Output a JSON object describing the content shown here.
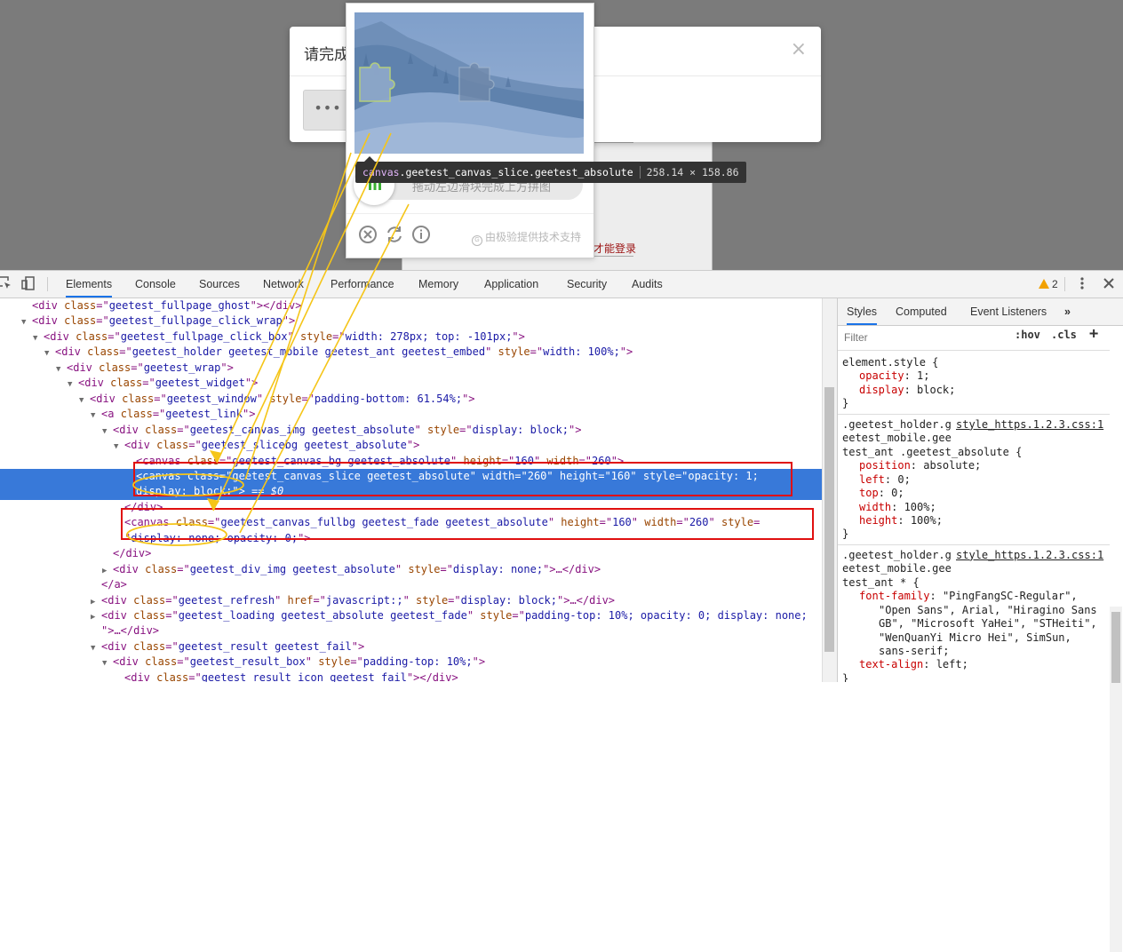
{
  "page": {
    "modal_title": "请完成",
    "modal_close": "×",
    "modal_button": "•••",
    "login_hint": "才能登录"
  },
  "geetest": {
    "slider_hint": "拖动左边滑块完成上方拼图",
    "brand_text": "由极验提供技术支持",
    "brand_mark": "G"
  },
  "tooltip": {
    "tag": "canvas",
    "classes": ".geetest_canvas_slice.geetest_absolute",
    "size": "258.14 × 158.86"
  },
  "devtools": {
    "tabs": [
      "Elements",
      "Console",
      "Sources",
      "Network",
      "Performance",
      "Memory",
      "Application",
      "Security",
      "Audits"
    ],
    "active_tab": "Elements",
    "warnings": "2"
  },
  "dom_lines": [
    {
      "indent": 2,
      "tri": "",
      "parts": [
        [
          "tg",
          "<div "
        ],
        [
          "an",
          "class"
        ],
        [
          "tg",
          "=\""
        ],
        [
          "av",
          "geetest_fullpage_ghost"
        ],
        [
          "tg",
          "\"></div>"
        ]
      ]
    },
    {
      "indent": 2,
      "tri": "▼",
      "parts": [
        [
          "tg",
          "<div "
        ],
        [
          "an",
          "class"
        ],
        [
          "tg",
          "=\""
        ],
        [
          "av",
          "geetest_fullpage_click_wrap"
        ],
        [
          "tg",
          "\">"
        ]
      ]
    },
    {
      "indent": 3,
      "tri": "▼",
      "parts": [
        [
          "tg",
          "<div "
        ],
        [
          "an",
          "class"
        ],
        [
          "tg",
          "=\""
        ],
        [
          "av",
          "geetest_fullpage_click_box"
        ],
        [
          "tg",
          "\" "
        ],
        [
          "an",
          "style"
        ],
        [
          "tg",
          "=\""
        ],
        [
          "av",
          "width: 278px; top: -101px;"
        ],
        [
          "tg",
          "\">"
        ]
      ]
    },
    {
      "indent": 4,
      "tri": "▼",
      "parts": [
        [
          "tg",
          "<div "
        ],
        [
          "an",
          "class"
        ],
        [
          "tg",
          "=\""
        ],
        [
          "av",
          "geetest_holder geetest_mobile geetest_ant geetest_embed"
        ],
        [
          "tg",
          "\" "
        ],
        [
          "an",
          "style"
        ],
        [
          "tg",
          "=\""
        ],
        [
          "av",
          "width: 100%;"
        ],
        [
          "tg",
          "\">"
        ]
      ]
    },
    {
      "indent": 5,
      "tri": "▼",
      "parts": [
        [
          "tg",
          "<div "
        ],
        [
          "an",
          "class"
        ],
        [
          "tg",
          "=\""
        ],
        [
          "av",
          "geetest_wrap"
        ],
        [
          "tg",
          "\">"
        ]
      ]
    },
    {
      "indent": 6,
      "tri": "▼",
      "parts": [
        [
          "tg",
          "<div "
        ],
        [
          "an",
          "class"
        ],
        [
          "tg",
          "=\""
        ],
        [
          "av",
          "geetest_widget"
        ],
        [
          "tg",
          "\">"
        ]
      ]
    },
    {
      "indent": 7,
      "tri": "▼",
      "parts": [
        [
          "tg",
          "<div "
        ],
        [
          "an",
          "class"
        ],
        [
          "tg",
          "=\""
        ],
        [
          "av",
          "geetest_window"
        ],
        [
          "tg",
          "\" "
        ],
        [
          "an",
          "style"
        ],
        [
          "tg",
          "=\""
        ],
        [
          "av",
          "padding-bottom: 61.54%;"
        ],
        [
          "tg",
          "\">"
        ]
      ]
    },
    {
      "indent": 8,
      "tri": "▼",
      "parts": [
        [
          "tg",
          "<a "
        ],
        [
          "an",
          "class"
        ],
        [
          "tg",
          "=\""
        ],
        [
          "av",
          "geetest_link"
        ],
        [
          "tg",
          "\">"
        ]
      ]
    },
    {
      "indent": 9,
      "tri": "▼",
      "parts": [
        [
          "tg",
          "<div "
        ],
        [
          "an",
          "class"
        ],
        [
          "tg",
          "=\""
        ],
        [
          "av",
          "geetest_canvas_img geetest_absolute"
        ],
        [
          "tg",
          "\" "
        ],
        [
          "an",
          "style"
        ],
        [
          "tg",
          "=\""
        ],
        [
          "av",
          "display: block;"
        ],
        [
          "tg",
          "\">"
        ]
      ]
    },
    {
      "indent": 10,
      "tri": "▼",
      "parts": [
        [
          "tg",
          "<div "
        ],
        [
          "an",
          "class"
        ],
        [
          "tg",
          "=\""
        ],
        [
          "av",
          "geetest_slicebg geetest_absolute"
        ],
        [
          "tg",
          "\">"
        ]
      ]
    },
    {
      "indent": 11,
      "tri": "",
      "parts": [
        [
          "tg",
          "<canvas "
        ],
        [
          "an",
          "class"
        ],
        [
          "tg",
          "=\""
        ],
        [
          "av",
          "geetest_canvas_bg geetest_absolute"
        ],
        [
          "tg",
          "\" "
        ],
        [
          "an",
          "height"
        ],
        [
          "tg",
          "=\""
        ],
        [
          "av",
          "160"
        ],
        [
          "tg",
          "\" "
        ],
        [
          "an",
          "width"
        ],
        [
          "tg",
          "=\""
        ],
        [
          "av",
          "260"
        ],
        [
          "tg",
          "\">"
        ]
      ]
    },
    {
      "indent": 11,
      "tri": "",
      "selected": true,
      "parts": [
        [
          "tg",
          "<canvas "
        ],
        [
          "an",
          "class"
        ],
        [
          "tg",
          "=\""
        ],
        [
          "av",
          "geetest_canvas_slice geetest_absolute"
        ],
        [
          "tg",
          "\" "
        ],
        [
          "an",
          "width"
        ],
        [
          "tg",
          "=\""
        ],
        [
          "av",
          "260"
        ],
        [
          "tg",
          "\" "
        ],
        [
          "an",
          "height"
        ],
        [
          "tg",
          "=\""
        ],
        [
          "av",
          "160"
        ],
        [
          "tg",
          "\" "
        ],
        [
          "an",
          "style"
        ],
        [
          "tg",
          "=\""
        ],
        [
          "av",
          "opacity: 1;"
        ]
      ]
    },
    {
      "indent": 11,
      "tri": "",
      "selected": true,
      "parts": [
        [
          "av",
          "display: block;"
        ],
        [
          "tg",
          "\">"
        ],
        [
          "dim",
          " == $0"
        ]
      ]
    },
    {
      "indent": 10,
      "tri": "",
      "parts": [
        [
          "tg",
          "</div>"
        ]
      ]
    },
    {
      "indent": 10,
      "tri": "",
      "parts": [
        [
          "tg",
          "<canvas "
        ],
        [
          "an",
          "class"
        ],
        [
          "tg",
          "=\""
        ],
        [
          "av",
          "geetest_canvas_fullbg geetest_fade geetest_absolute"
        ],
        [
          "tg",
          "\" "
        ],
        [
          "an",
          "height"
        ],
        [
          "tg",
          "=\""
        ],
        [
          "av",
          "160"
        ],
        [
          "tg",
          "\" "
        ],
        [
          "an",
          "width"
        ],
        [
          "tg",
          "=\""
        ],
        [
          "av",
          "260"
        ],
        [
          "tg",
          "\" "
        ],
        [
          "an",
          "style"
        ],
        [
          "tg",
          "="
        ]
      ]
    },
    {
      "indent": 10,
      "tri": "",
      "parts": [
        [
          "tg",
          "\""
        ],
        [
          "av",
          "display: none; opacity: 0;"
        ],
        [
          "tg",
          "\">"
        ]
      ]
    },
    {
      "indent": 9,
      "tri": "",
      "parts": [
        [
          "tg",
          "</div>"
        ]
      ]
    },
    {
      "indent": 9,
      "tri": "▶",
      "parts": [
        [
          "tg",
          "<div "
        ],
        [
          "an",
          "class"
        ],
        [
          "tg",
          "=\""
        ],
        [
          "av",
          "geetest_div_img geetest_absolute"
        ],
        [
          "tg",
          "\" "
        ],
        [
          "an",
          "style"
        ],
        [
          "tg",
          "=\""
        ],
        [
          "av",
          "display: none;"
        ],
        [
          "tg",
          "\">…</div>"
        ]
      ]
    },
    {
      "indent": 8,
      "tri": "",
      "parts": [
        [
          "tg",
          "</a>"
        ]
      ]
    },
    {
      "indent": 8,
      "tri": "▶",
      "parts": [
        [
          "tg",
          "<div "
        ],
        [
          "an",
          "class"
        ],
        [
          "tg",
          "=\""
        ],
        [
          "av",
          "geetest_refresh"
        ],
        [
          "tg",
          "\" "
        ],
        [
          "an",
          "href"
        ],
        [
          "tg",
          "=\""
        ],
        [
          "av",
          "javascript:;"
        ],
        [
          "tg",
          "\" "
        ],
        [
          "an",
          "style"
        ],
        [
          "tg",
          "=\""
        ],
        [
          "av",
          "display: block;"
        ],
        [
          "tg",
          "\">…</div>"
        ]
      ]
    },
    {
      "indent": 8,
      "tri": "▶",
      "parts": [
        [
          "tg",
          "<div "
        ],
        [
          "an",
          "class"
        ],
        [
          "tg",
          "=\""
        ],
        [
          "av",
          "geetest_loading geetest_absolute geetest_fade"
        ],
        [
          "tg",
          "\" "
        ],
        [
          "an",
          "style"
        ],
        [
          "tg",
          "=\""
        ],
        [
          "av",
          "padding-top: 10%; opacity: 0; display: none;"
        ]
      ]
    },
    {
      "indent": 8,
      "tri": "",
      "parts": [
        [
          "tg",
          "\">…</div>"
        ]
      ]
    },
    {
      "indent": 8,
      "tri": "▼",
      "parts": [
        [
          "tg",
          "<div "
        ],
        [
          "an",
          "class"
        ],
        [
          "tg",
          "=\""
        ],
        [
          "av",
          "geetest_result geetest_fail"
        ],
        [
          "tg",
          "\">"
        ]
      ]
    },
    {
      "indent": 9,
      "tri": "▼",
      "parts": [
        [
          "tg",
          "<div "
        ],
        [
          "an",
          "class"
        ],
        [
          "tg",
          "=\""
        ],
        [
          "av",
          "geetest_result_box"
        ],
        [
          "tg",
          "\" "
        ],
        [
          "an",
          "style"
        ],
        [
          "tg",
          "=\""
        ],
        [
          "av",
          "padding-top: 10%;"
        ],
        [
          "tg",
          "\">"
        ]
      ]
    },
    {
      "indent": 10,
      "tri": "",
      "parts": [
        [
          "tg",
          "<div "
        ],
        [
          "an",
          "class"
        ],
        [
          "tg",
          "=\""
        ],
        [
          "av",
          "geetest_result_icon geetest_fail"
        ],
        [
          "tg",
          "\"></div>"
        ]
      ]
    }
  ],
  "styles_pane": {
    "tabs": [
      "Styles",
      "Computed",
      "Event Listeners"
    ],
    "active_tab": "Styles",
    "filter_placeholder": "Filter",
    "hov": ":hov",
    "cls": ".cls",
    "plus": "+",
    "lines": [
      {
        "t": "plain",
        "text": "element.style {"
      },
      {
        "t": "prop",
        "name": "opacity",
        "value": "1;"
      },
      {
        "t": "prop",
        "name": "display",
        "value": "block;"
      },
      {
        "t": "plain",
        "text": "}"
      },
      {
        "t": "sep"
      },
      {
        "t": "selector",
        "text": ".geetest_holder.g",
        "link": "style_https.1.2.3.css:1"
      },
      {
        "t": "plain",
        "text": "eetest_mobile.gee"
      },
      {
        "t": "plain",
        "text": "test_ant .geetest_absolute {"
      },
      {
        "t": "prop",
        "name": "position",
        "value": "absolute;"
      },
      {
        "t": "prop",
        "name": "left",
        "value": "0;"
      },
      {
        "t": "prop",
        "name": "top",
        "value": "0;"
      },
      {
        "t": "prop",
        "name": "width",
        "value": "100%;"
      },
      {
        "t": "prop",
        "name": "height",
        "value": "100%;"
      },
      {
        "t": "plain",
        "text": "}"
      },
      {
        "t": "sep"
      },
      {
        "t": "selector",
        "text": ".geetest_holder.g",
        "link": "style_https.1.2.3.css:1"
      },
      {
        "t": "plain",
        "text": "eetest_mobile.gee"
      },
      {
        "t": "plain",
        "text": "test_ant * {"
      },
      {
        "t": "prop",
        "name": "font-family",
        "value": "\"PingFangSC-Regular\","
      },
      {
        "t": "cont",
        "text": "\"Open Sans\", Arial, \"Hiragino Sans"
      },
      {
        "t": "cont",
        "text": "GB\", \"Microsoft YaHei\", \"STHeiti\","
      },
      {
        "t": "cont",
        "text": "\"WenQuanYi Micro Hei\", SimSun,"
      },
      {
        "t": "cont",
        "text": "sans-serif;"
      },
      {
        "t": "prop",
        "name": "text-align",
        "value": "left;"
      },
      {
        "t": "plain",
        "text": "}"
      }
    ]
  },
  "colors": {
    "selection": "#3879d9",
    "highlight_box": "#e01010",
    "annotation": "#f5c518"
  }
}
